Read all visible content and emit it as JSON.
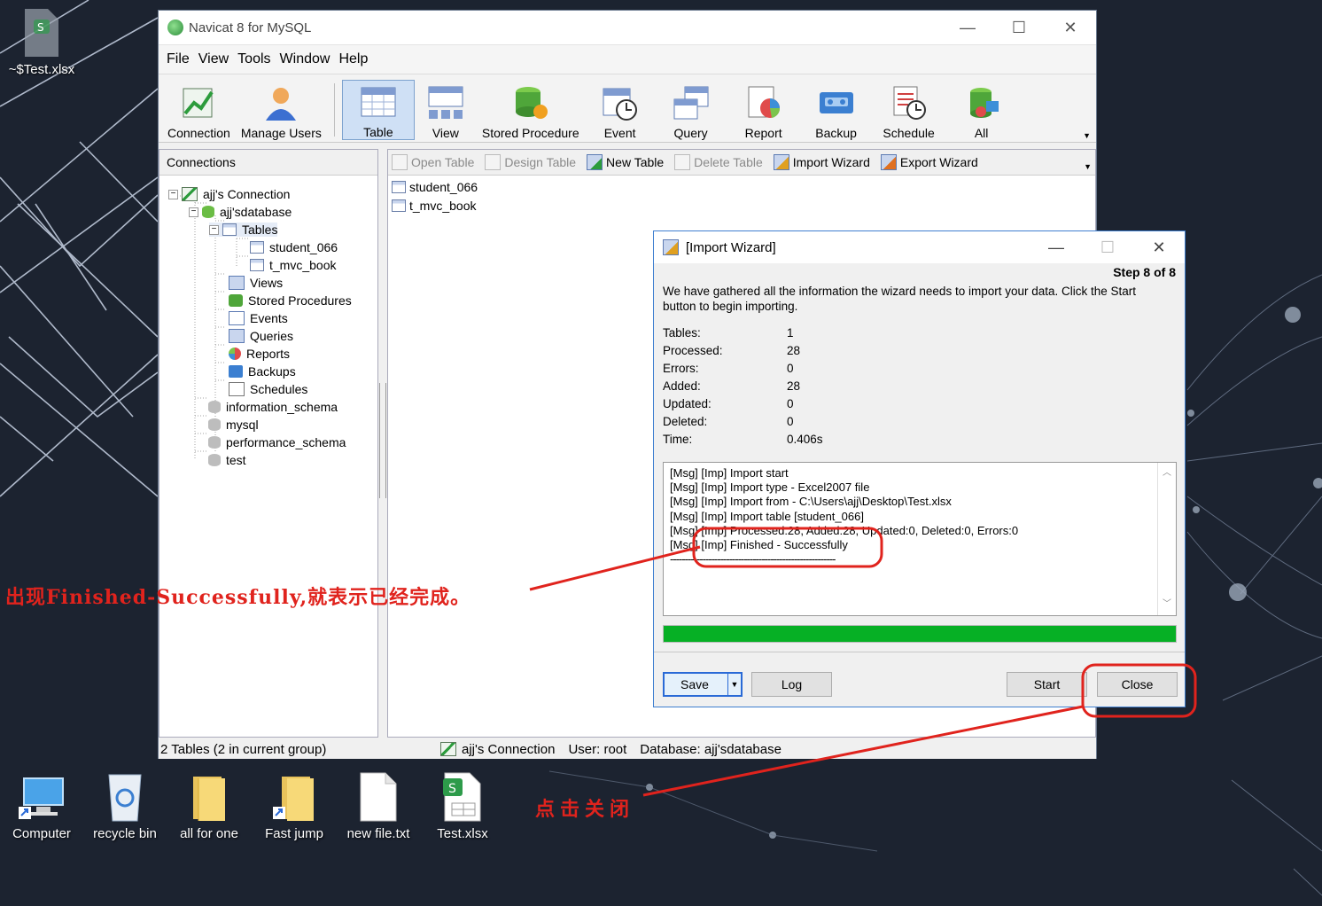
{
  "desktop": {
    "top_file": "~$Test.xlsx",
    "icons": [
      "Computer",
      "recycle bin",
      "all for one",
      "Fast jump",
      "new file.txt",
      "Test.xlsx"
    ]
  },
  "window": {
    "title": "Navicat 8 for MySQL",
    "menu": [
      "File",
      "View",
      "Tools",
      "Window",
      "Help"
    ],
    "toolbar": [
      "Connection",
      "Manage Users",
      "Table",
      "View",
      "Stored Procedure",
      "Event",
      "Query",
      "Report",
      "Backup",
      "Schedule",
      "All"
    ],
    "active_tool": "Table"
  },
  "connections": {
    "header": "Connections",
    "tree": {
      "connection": "ajj's Connection",
      "database": "ajj'sdatabase",
      "tables_node": "Tables",
      "tables": [
        "student_066",
        "t_mvc_book"
      ],
      "nodes": [
        "Views",
        "Stored Procedures",
        "Events",
        "Queries",
        "Reports",
        "Backups",
        "Schedules"
      ],
      "other_dbs": [
        "information_schema",
        "mysql",
        "performance_schema",
        "test"
      ]
    }
  },
  "object_bar": {
    "open_table": "Open Table",
    "design_table": "Design Table",
    "new_table": "New Table",
    "delete_table": "Delete Table",
    "import_wizard": "Import Wizard",
    "export_wizard": "Export Wizard"
  },
  "objects": [
    "student_066",
    "t_mvc_book"
  ],
  "status": {
    "left": "2 Tables (2 in current group)",
    "connection": "ajj's Connection",
    "user": "User: root",
    "database": "Database: ajj'sdatabase"
  },
  "dialog": {
    "title": "[Import Wizard]",
    "step": "Step 8 of 8",
    "description": "We have gathered all the information the wizard needs to import your data. Click the Start button to begin importing.",
    "stats": [
      {
        "label": "Tables:",
        "value": "1"
      },
      {
        "label": "Processed:",
        "value": "28"
      },
      {
        "label": "Errors:",
        "value": "0"
      },
      {
        "label": "Added:",
        "value": "28"
      },
      {
        "label": "Updated:",
        "value": "0"
      },
      {
        "label": "Deleted:",
        "value": "0"
      },
      {
        "label": "Time:",
        "value": "0.406s"
      }
    ],
    "log": [
      "[Msg] [Imp] Import start",
      "[Msg] [Imp] Import type - Excel2007 file",
      "[Msg] [Imp] Import from - C:\\Users\\ajj\\Desktop\\Test.xlsx",
      "[Msg] [Imp] Import table [student_066]",
      "[Msg] [Imp] Processed:28, Added:28, Updated:0, Deleted:0, Errors:0",
      "[Msg] [Imp] Finished - Successfully",
      "--------------------------------------------------------"
    ],
    "progress": 1.0,
    "buttons": {
      "save": "Save",
      "log": "Log",
      "start": "Start",
      "close": "Close"
    }
  },
  "annotations": {
    "finished_note": "出现Finished-Successfully,就表示已经完成。",
    "close_note": "点击关闭"
  },
  "colors": {
    "annotation_red": "#e0231d",
    "progress_green": "#06b025",
    "desktop_bg": "#1c2330"
  }
}
